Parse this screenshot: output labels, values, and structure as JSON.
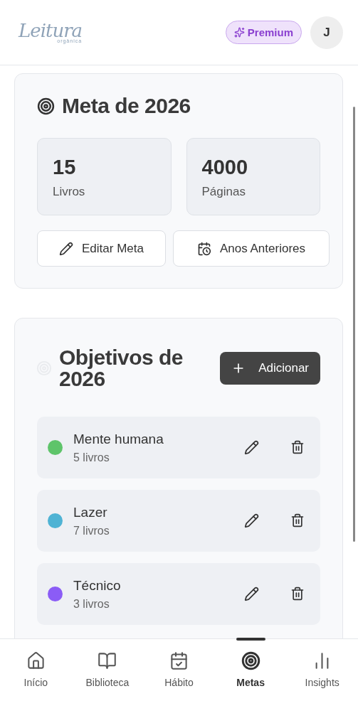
{
  "header": {
    "logo": {
      "title": "Leitura",
      "subtitle": "orgânica"
    },
    "premium_label": "Premium",
    "avatar_initial": "J"
  },
  "goal_card": {
    "title": "Meta de 2026",
    "stats": [
      {
        "value": "15",
        "label": "Livros"
      },
      {
        "value": "4000",
        "label": "Páginas"
      }
    ],
    "actions": [
      {
        "kind": "edit",
        "label": "Editar Meta"
      },
      {
        "kind": "history",
        "label": "Anos Anteriores"
      }
    ]
  },
  "objectives_card": {
    "title": "Objetivos de 2026",
    "add_label": "Adicionar",
    "items": [
      {
        "name": "Mente humana",
        "count": "5 livros",
        "color": "#5ec46a"
      },
      {
        "name": "Lazer",
        "count": "7 livros",
        "color": "#4fb3d4"
      },
      {
        "name": "Técnico",
        "count": "3 livros",
        "color": "#8b5cf6"
      }
    ]
  },
  "nav": [
    {
      "kind": "home",
      "label": "Início",
      "selected": false
    },
    {
      "kind": "library",
      "label": "Biblioteca",
      "selected": false
    },
    {
      "kind": "habit",
      "label": "Hábito",
      "selected": false
    },
    {
      "kind": "goals",
      "label": "Metas",
      "selected": true
    },
    {
      "kind": "insights",
      "label": "Insights",
      "selected": false
    }
  ]
}
